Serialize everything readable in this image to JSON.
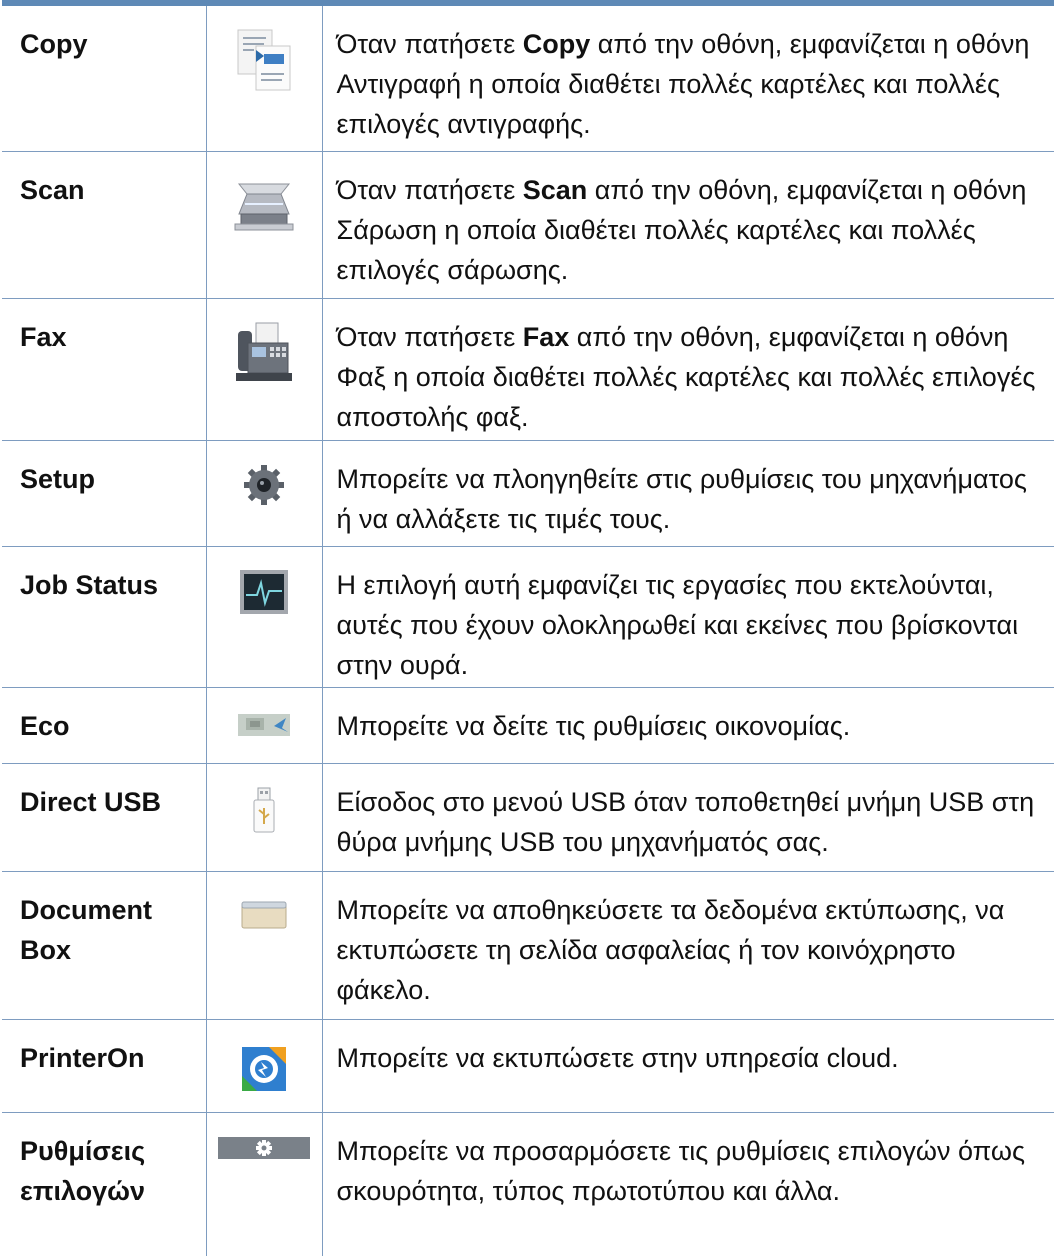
{
  "rows": [
    {
      "name": "Copy",
      "icon": "copy-icon",
      "desc_pre": "Όταν πατήσετε ",
      "desc_bold": "Copy",
      "desc_post": " από την οθόνη, εμφανίζεται η οθόνη Αντιγραφή η οποία διαθέτει πολλές καρτέλες και πολλές επιλογές αντιγραφής."
    },
    {
      "name": "Scan",
      "icon": "scan-icon",
      "desc_pre": "Όταν πατήσετε ",
      "desc_bold": "Scan",
      "desc_post": " από την οθόνη, εμφανίζεται η οθόνη Σάρωση η οποία διαθέτει πολλές καρτέλες και πολλές επιλογές σάρωσης."
    },
    {
      "name": "Fax",
      "icon": "fax-icon",
      "desc_pre": "Όταν πατήσετε ",
      "desc_bold": "Fax",
      "desc_post": " από την οθόνη, εμφανίζεται η οθόνη Φαξ η οποία διαθέτει πολλές καρτέλες και πολλές επιλογές αποστολής φαξ."
    },
    {
      "name": "Setup",
      "icon": "setup-gear-icon",
      "desc_pre": "Μπορείτε να πλοηγηθείτε στις ρυθμίσεις του μηχανήματος ή να αλλάξετε τις τιμές τους.",
      "desc_bold": "",
      "desc_post": ""
    },
    {
      "name": "Job Status",
      "icon": "job-status-icon",
      "desc_pre": "Η επιλογή αυτή εμφανίζει τις εργασίες που εκτελούνται, αυτές που έχουν ολοκληρωθεί και εκείνες που βρίσκονται στην ουρά.",
      "desc_bold": "",
      "desc_post": ""
    },
    {
      "name": "Eco",
      "icon": "eco-icon",
      "desc_pre": "Μπορείτε να δείτε τις ρυθμίσεις οικονομίας.",
      "desc_bold": "",
      "desc_post": ""
    },
    {
      "name": "Direct USB",
      "icon": "usb-icon",
      "desc_pre": "Είσοδος στο μενού USB όταν τοποθετηθεί μνήμη USB στη θύρα μνήμης USB του μηχανήματός σας.",
      "desc_bold": "",
      "desc_post": ""
    },
    {
      "name": "Document Box",
      "icon": "document-box-icon",
      "desc_pre": "Μπορείτε να αποθηκεύσετε τα δεδομένα εκτύπωσης, να εκτυπώσετε τη σελίδα ασφαλείας ή τον κοινόχρηστο φάκελο.",
      "desc_bold": "",
      "desc_post": ""
    },
    {
      "name": "PrinterOn",
      "icon": "printeron-icon",
      "desc_pre": "Μπορείτε να εκτυπώσετε στην υπηρεσία cloud.",
      "desc_bold": "",
      "desc_post": ""
    },
    {
      "name": "Ρυθμίσεις επιλογών",
      "icon": "options-settings-icon",
      "desc_pre": "Μπορείτε να προσαρμόσετε τις ρυθμίσεις επιλογών όπως σκουρότητα, τύπος πρωτοτύπου και άλλα.",
      "desc_bold": "",
      "desc_post": ""
    }
  ]
}
